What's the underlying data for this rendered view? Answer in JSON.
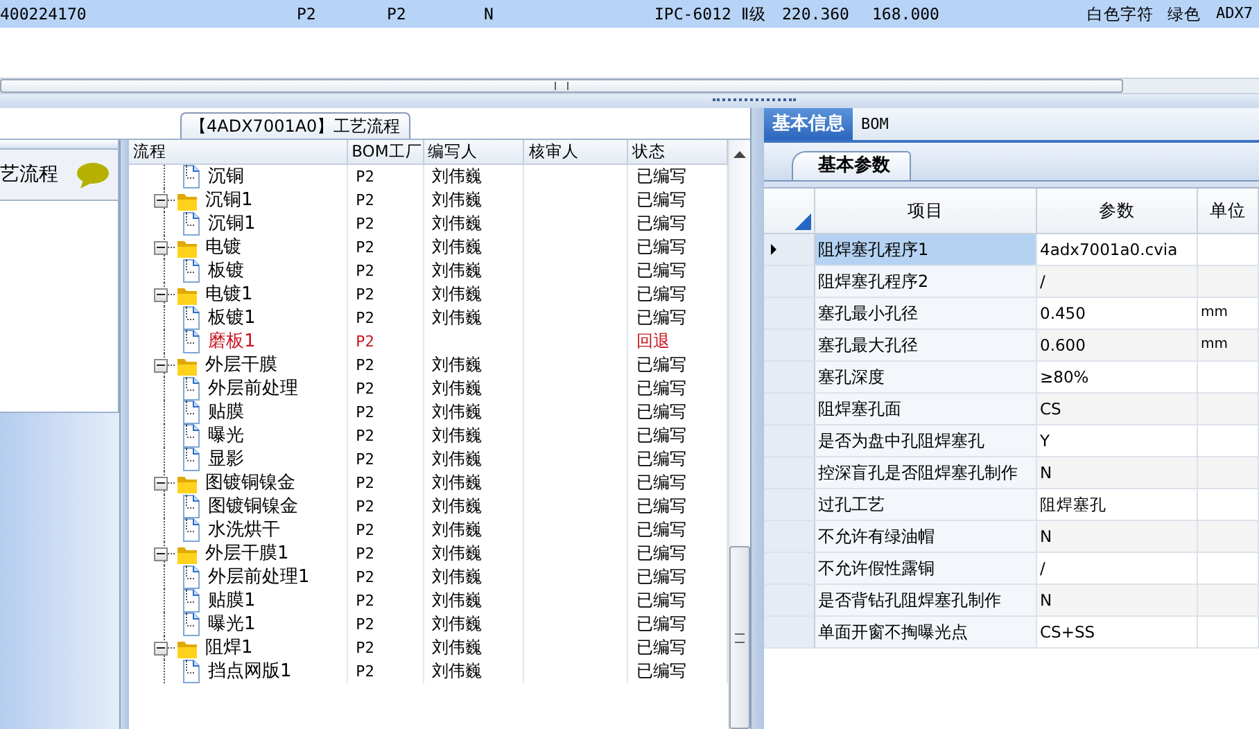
{
  "top_grid": {
    "rows": [
      {
        "selected": true,
        "cells": [
          "400224170",
          "P2",
          "P2",
          "N",
          "IPC-6012 Ⅱ级",
          "220.360",
          "168.000",
          "白色字符",
          "绿色",
          "ADX7"
        ]
      }
    ]
  },
  "process_panel": {
    "title": "【4ADX7001A0】工艺流程",
    "sidebar": {
      "items": [
        {
          "label": "艺流程"
        }
      ]
    },
    "tree": {
      "columns": [
        "流程",
        "BOM工厂",
        "编写人",
        "核审人",
        "状态"
      ],
      "rows": [
        {
          "kind": "leaf",
          "label": "沉铜",
          "bom": "P2",
          "author": "刘伟巍",
          "status": "已编写",
          "returned": false
        },
        {
          "kind": "folder",
          "label": "沉铜1",
          "bom": "P2",
          "author": "刘伟巍",
          "status": "已编写",
          "returned": false,
          "expanded": true,
          "children": [
            {
              "kind": "leaf",
              "label": "沉铜1",
              "bom": "P2",
              "author": "刘伟巍",
              "status": "已编写",
              "returned": false
            }
          ]
        },
        {
          "kind": "folder",
          "label": "电镀",
          "bom": "P2",
          "author": "刘伟巍",
          "status": "已编写",
          "returned": false,
          "expanded": true,
          "children": [
            {
              "kind": "leaf",
              "label": "板镀",
              "bom": "P2",
              "author": "刘伟巍",
              "status": "已编写",
              "returned": false
            }
          ]
        },
        {
          "kind": "folder",
          "label": "电镀1",
          "bom": "P2",
          "author": "刘伟巍",
          "status": "已编写",
          "returned": false,
          "expanded": true,
          "children": [
            {
              "kind": "leaf",
              "label": "板镀1",
              "bom": "P2",
              "author": "刘伟巍",
              "status": "已编写",
              "returned": false
            },
            {
              "kind": "leaf",
              "label": "磨板1",
              "bom": "P2",
              "status": "回退",
              "returned": true
            }
          ]
        },
        {
          "kind": "folder",
          "label": "外层干膜",
          "bom": "P2",
          "author": "刘伟巍",
          "status": "已编写",
          "returned": false,
          "expanded": true,
          "children": [
            {
              "kind": "leaf",
              "label": "外层前处理",
              "bom": "P2",
              "author": "刘伟巍",
              "status": "已编写",
              "returned": false
            },
            {
              "kind": "leaf",
              "label": "贴膜",
              "bom": "P2",
              "author": "刘伟巍",
              "status": "已编写",
              "returned": false
            },
            {
              "kind": "leaf",
              "label": "曝光",
              "bom": "P2",
              "author": "刘伟巍",
              "status": "已编写",
              "returned": false
            },
            {
              "kind": "leaf",
              "label": "显影",
              "bom": "P2",
              "author": "刘伟巍",
              "status": "已编写",
              "returned": false
            }
          ]
        },
        {
          "kind": "folder",
          "label": "图镀铜镍金",
          "bom": "P2",
          "author": "刘伟巍",
          "status": "已编写",
          "returned": false,
          "expanded": true,
          "children": [
            {
              "kind": "leaf",
              "label": "图镀铜镍金",
              "bom": "P2",
              "author": "刘伟巍",
              "status": "已编写",
              "returned": false
            },
            {
              "kind": "leaf",
              "label": "水洗烘干",
              "bom": "P2",
              "author": "刘伟巍",
              "status": "已编写",
              "returned": false
            }
          ]
        },
        {
          "kind": "folder",
          "label": "外层干膜1",
          "bom": "P2",
          "author": "刘伟巍",
          "status": "已编写",
          "returned": false,
          "expanded": true,
          "children": [
            {
              "kind": "leaf",
              "label": "外层前处理1",
              "bom": "P2",
              "author": "刘伟巍",
              "status": "已编写",
              "returned": false
            },
            {
              "kind": "leaf",
              "label": "贴膜1",
              "bom": "P2",
              "author": "刘伟巍",
              "status": "已编写",
              "returned": false
            },
            {
              "kind": "leaf",
              "label": "曝光1",
              "bom": "P2",
              "author": "刘伟巍",
              "status": "已编写",
              "returned": false
            }
          ]
        },
        {
          "kind": "folder",
          "label": "阻焊1",
          "bom": "P2",
          "author": "刘伟巍",
          "status": "已编写",
          "returned": false,
          "expanded": true,
          "children": [
            {
              "kind": "leaf",
              "label": "挡点网版1",
              "bom": "P2",
              "author": "刘伟巍",
              "status": "已编写",
              "returned": false
            }
          ]
        }
      ]
    }
  },
  "detail_panel": {
    "tabs": [
      {
        "label": "基本信息",
        "selected": true
      },
      {
        "label": "BOM",
        "selected": false
      }
    ],
    "subtabs": [
      {
        "label": "基本参数",
        "selected": true
      }
    ],
    "grid": {
      "columns": [
        "项目",
        "参数",
        "单位"
      ],
      "rows": [
        {
          "item": "阻焊塞孔程序1",
          "value": "4adx7001a0.cvia",
          "selected": true
        },
        {
          "item": "阻焊塞孔程序2",
          "value": "/",
          "selected": false
        },
        {
          "item": "塞孔最小孔径",
          "value": "0.450",
          "unit": "mm",
          "selected": false
        },
        {
          "item": "塞孔最大孔径",
          "value": "0.600",
          "unit": "mm",
          "selected": false
        },
        {
          "item": "塞孔深度",
          "value": "≥80%",
          "selected": false
        },
        {
          "item": "阻焊塞孔面",
          "value": "CS",
          "selected": false
        },
        {
          "item": "是否为盘中孔阻焊塞孔",
          "value": "Y",
          "selected": false
        },
        {
          "item": "控深盲孔是否阻焊塞孔制作",
          "value": "N",
          "selected": false
        },
        {
          "item": "过孔工艺",
          "value": "阻焊塞孔",
          "selected": false
        },
        {
          "item": "不允许有绿油帽",
          "value": "N",
          "selected": false
        },
        {
          "item": "不允许假性露铜",
          "value": "/",
          "selected": false
        },
        {
          "item": "是否背钻孔阻焊塞孔制作",
          "value": "N",
          "selected": false
        },
        {
          "item": "单面开窗不掏曝光点",
          "value": "CS+SS",
          "selected": false
        }
      ]
    }
  }
}
